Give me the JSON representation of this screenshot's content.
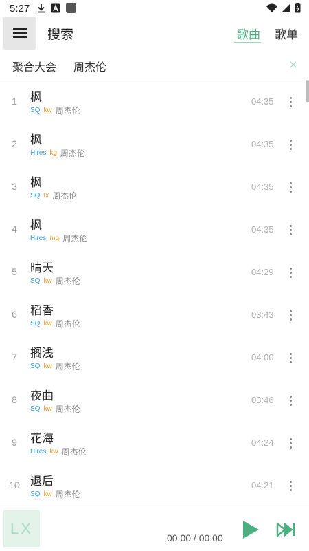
{
  "status_bar": {
    "time": "5:27"
  },
  "header": {
    "title": "搜索",
    "tabs": {
      "songs": "歌曲",
      "playlists": "歌单"
    }
  },
  "search": {
    "source": "聚合大会",
    "query": "周杰伦"
  },
  "songs": [
    {
      "num": "1",
      "title": "枫",
      "quality": "SQ",
      "source": "kw",
      "artist": "周杰伦",
      "duration": "04:35"
    },
    {
      "num": "2",
      "title": "枫",
      "quality": "Hires",
      "source": "kg",
      "artist": "周杰伦",
      "duration": "04:35"
    },
    {
      "num": "3",
      "title": "枫",
      "quality": "SQ",
      "source": "tx",
      "artist": "周杰伦",
      "duration": "04:35"
    },
    {
      "num": "4",
      "title": "枫",
      "quality": "Hires",
      "source": "mg",
      "artist": "周杰伦",
      "duration": "04:35"
    },
    {
      "num": "5",
      "title": "晴天",
      "quality": "SQ",
      "source": "kw",
      "artist": "周杰伦",
      "duration": "04:29"
    },
    {
      "num": "6",
      "title": "稻香",
      "quality": "SQ",
      "source": "kw",
      "artist": "周杰伦",
      "duration": "03:43"
    },
    {
      "num": "7",
      "title": "搁浅",
      "quality": "SQ",
      "source": "kw",
      "artist": "周杰伦",
      "duration": "04:00"
    },
    {
      "num": "8",
      "title": "夜曲",
      "quality": "SQ",
      "source": "kw",
      "artist": "周杰伦",
      "duration": "03:46"
    },
    {
      "num": "9",
      "title": "花海",
      "quality": "Hires",
      "source": "kw",
      "artist": "周杰伦",
      "duration": "04:24"
    },
    {
      "num": "10",
      "title": "退后",
      "quality": "SQ",
      "source": "kw",
      "artist": "周杰伦",
      "duration": "04:21"
    }
  ],
  "player": {
    "cover_text": "LX",
    "time": "00:00 / 00:00"
  },
  "colors": {
    "accent": "#4dae82",
    "quality": "#3aa0e0",
    "source": "#e8a030"
  },
  "icons": [
    "menu-icon",
    "download-icon",
    "a-badge-icon",
    "square-icon",
    "wifi-icon",
    "signal-icon",
    "battery-icon",
    "close-icon",
    "more-vert-icon",
    "play-icon",
    "skip-next-icon"
  ]
}
